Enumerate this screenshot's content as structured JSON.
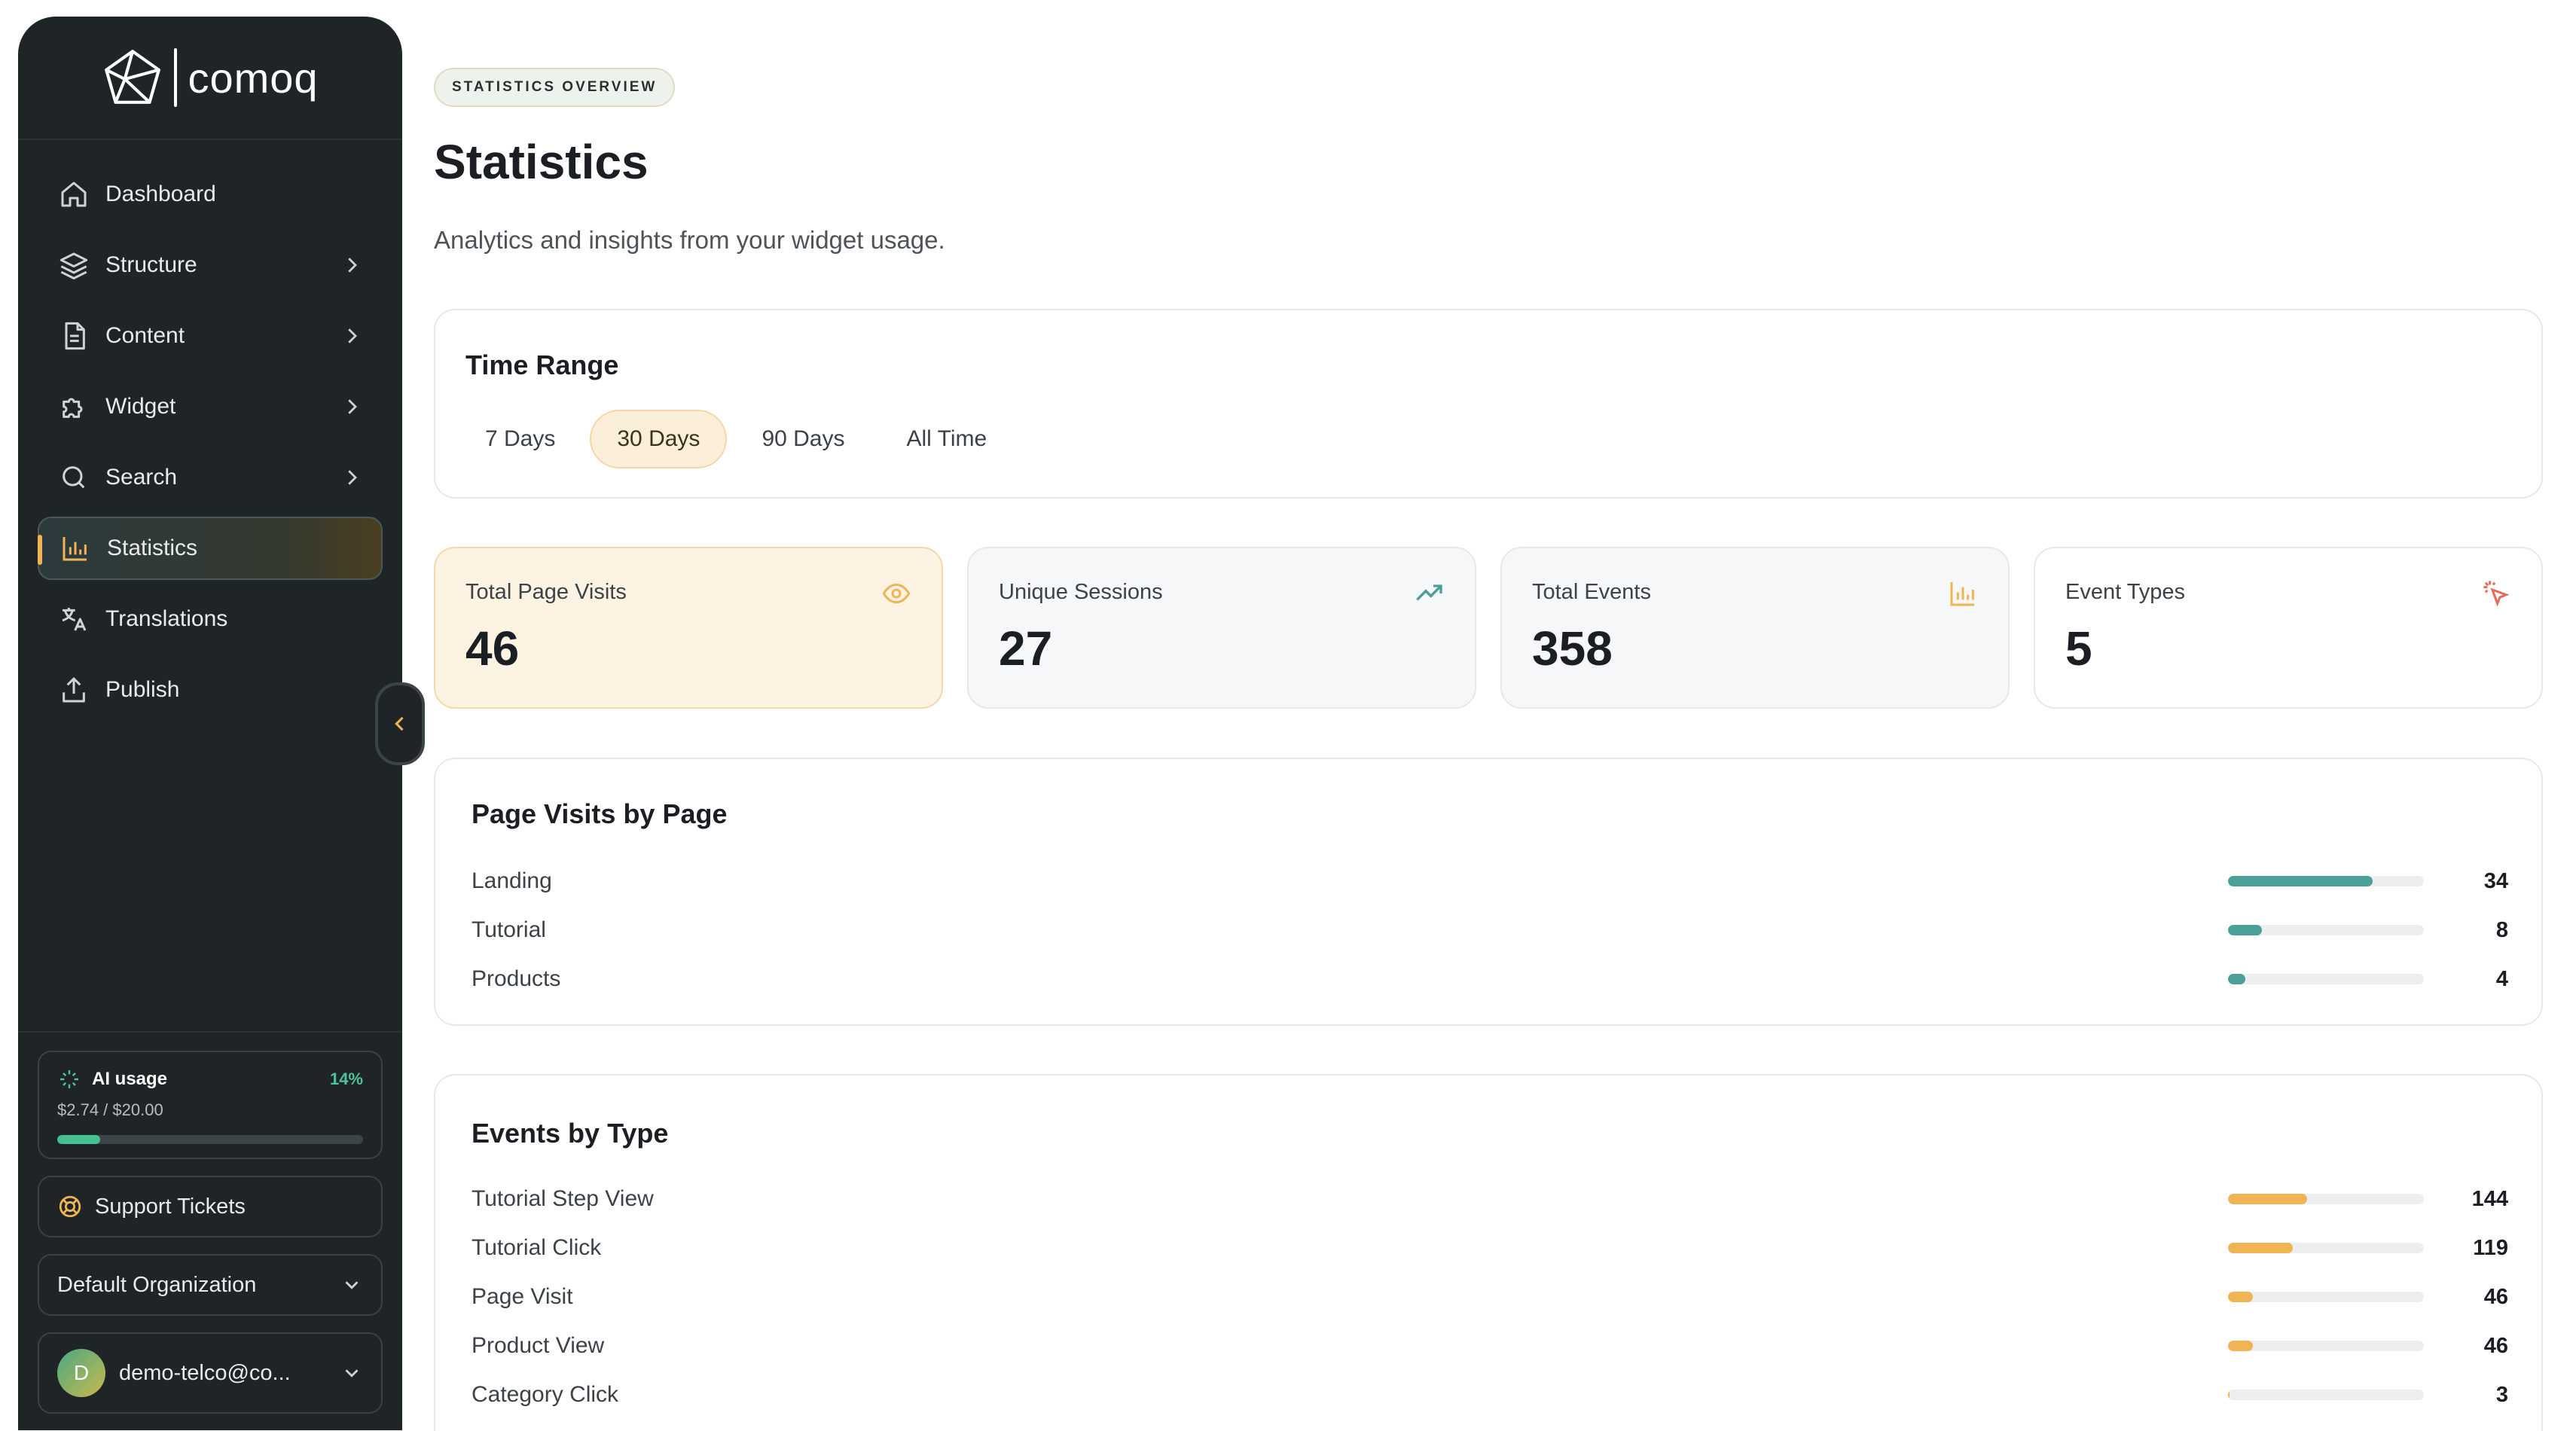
{
  "brand": {
    "name": "comoq"
  },
  "sidebar": {
    "items": [
      {
        "label": "Dashboard",
        "icon": "home-icon",
        "has_children": false,
        "active": false
      },
      {
        "label": "Structure",
        "icon": "layers-icon",
        "has_children": true,
        "active": false
      },
      {
        "label": "Content",
        "icon": "document-icon",
        "has_children": true,
        "active": false
      },
      {
        "label": "Widget",
        "icon": "puzzle-icon",
        "has_children": true,
        "active": false
      },
      {
        "label": "Search",
        "icon": "search-icon",
        "has_children": true,
        "active": false
      },
      {
        "label": "Statistics",
        "icon": "bar-chart-icon",
        "has_children": false,
        "active": true
      },
      {
        "label": "Translations",
        "icon": "translate-icon",
        "has_children": false,
        "active": false
      },
      {
        "label": "Publish",
        "icon": "upload-icon",
        "has_children": false,
        "active": false
      }
    ],
    "ai_usage": {
      "title": "AI usage",
      "percent_label": "14%",
      "cost": "$2.74 / $20.00",
      "fraction": 0.14
    },
    "support_label": "Support Tickets",
    "org_label": "Default Organization",
    "user": {
      "initial": "D",
      "email": "demo-telco@co..."
    }
  },
  "page": {
    "eyebrow": "STATISTICS OVERVIEW",
    "title": "Statistics",
    "subtitle": "Analytics and insights from your widget usage."
  },
  "time_range": {
    "title": "Time Range",
    "options": [
      "7 Days",
      "30 Days",
      "90 Days",
      "All Time"
    ],
    "selected": "30 Days"
  },
  "stats": [
    {
      "label": "Total Page Visits",
      "value": "46",
      "icon": "eye-icon"
    },
    {
      "label": "Unique Sessions",
      "value": "27",
      "icon": "trending-up-icon"
    },
    {
      "label": "Total Events",
      "value": "358",
      "icon": "bar-chart-icon"
    },
    {
      "label": "Event Types",
      "value": "5",
      "icon": "click-icon"
    }
  ],
  "page_visits": {
    "title": "Page Visits by Page",
    "rows": [
      {
        "label": "Landing",
        "value": "34",
        "fraction": 0.74
      },
      {
        "label": "Tutorial",
        "value": "8",
        "fraction": 0.174
      },
      {
        "label": "Products",
        "value": "4",
        "fraction": 0.087
      }
    ]
  },
  "events": {
    "title": "Events by Type",
    "rows": [
      {
        "label": "Tutorial Step View",
        "value": "144",
        "fraction": 0.402
      },
      {
        "label": "Tutorial Click",
        "value": "119",
        "fraction": 0.332
      },
      {
        "label": "Page Visit",
        "value": "46",
        "fraction": 0.128
      },
      {
        "label": "Product View",
        "value": "46",
        "fraction": 0.128
      },
      {
        "label": "Category Click",
        "value": "3",
        "fraction": 0.008
      }
    ]
  },
  "colors": {
    "accent": "#f0b454",
    "teal": "#4a9f98",
    "green": "#47c08f",
    "sidebar_bg": "#1f2427"
  }
}
